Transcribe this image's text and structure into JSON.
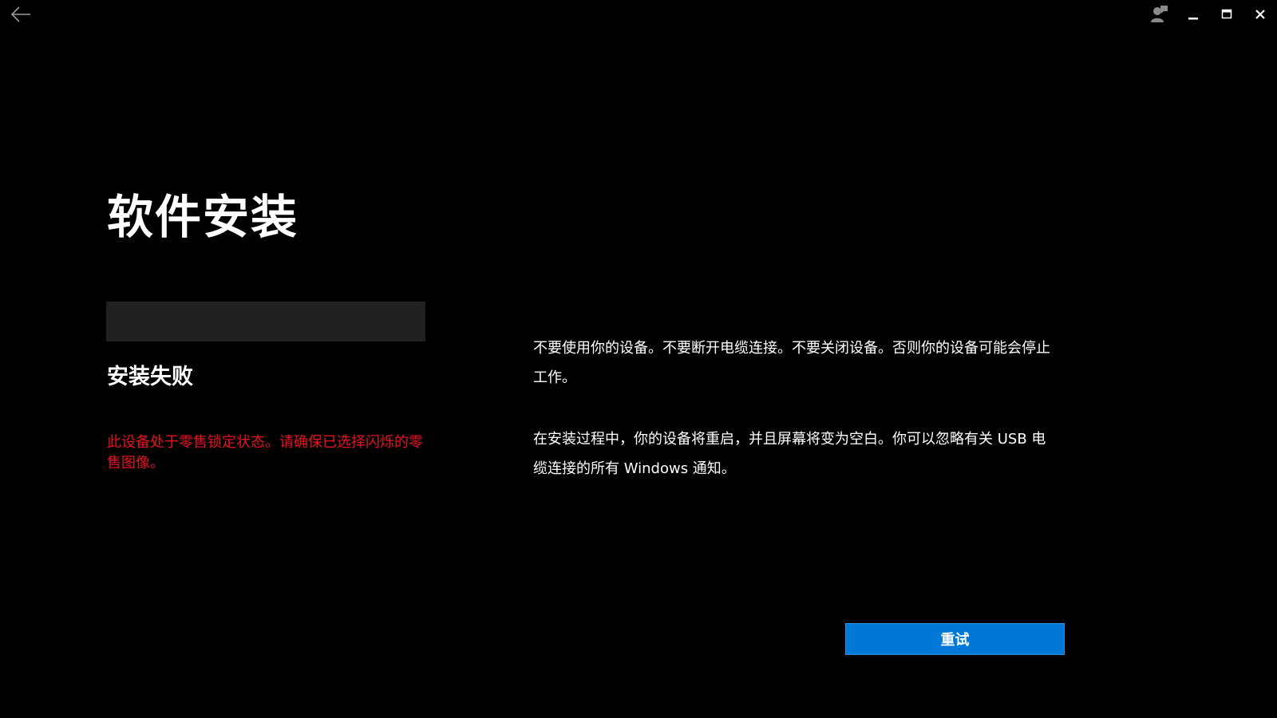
{
  "titlebar": {
    "back_icon": "arrow-left-icon",
    "controls": {
      "feedback_icon": "person-feedback-icon",
      "minimize_icon": "minimize-icon",
      "maximize_icon": "maximize-icon",
      "close_icon": "close-icon"
    }
  },
  "main": {
    "title": "软件安装",
    "progress": 0,
    "status": "安装失败",
    "error": "此设备处于零售锁定状态。请确保已选择闪烁的零售图像。"
  },
  "info": {
    "paragraph1": "不要使用你的设备。不要断开电缆连接。不要关闭设备。否则你的设备可能会停止工作。",
    "paragraph2": "在安装过程中，你的设备将重启，并且屏幕将变为空白。你可以忽略有关 USB 电缆连接的所有 Windows 通知。"
  },
  "actions": {
    "retry_label": "重试"
  },
  "colors": {
    "background": "#000000",
    "text": "#ffffff",
    "error": "#e81123",
    "accent": "#0078d7",
    "progress_track": "#212121"
  }
}
